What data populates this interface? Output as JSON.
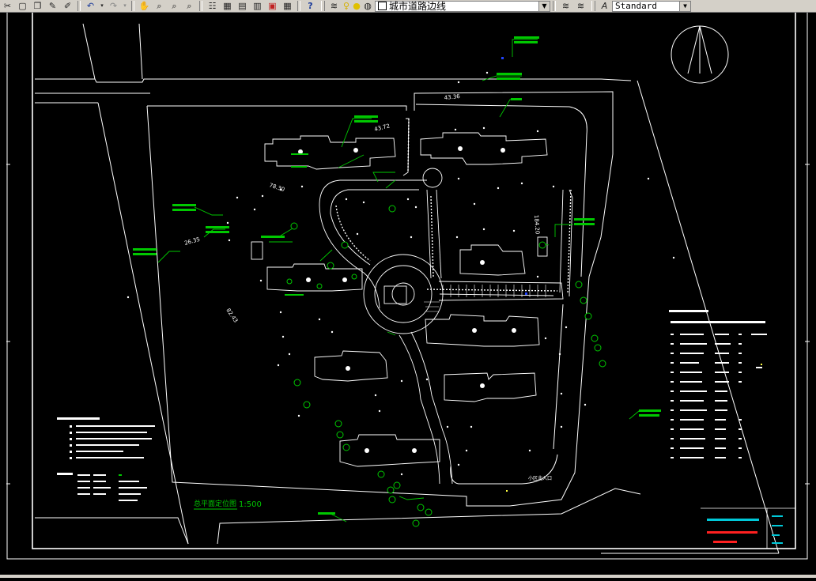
{
  "toolbar": {
    "icons": [
      "cut-icon",
      "new-icon",
      "open-icon",
      "pencil-icon",
      "paint-icon",
      "undo-icon",
      "undo-dropdown-icon",
      "redo-icon",
      "redo-dropdown-icon",
      "pan-icon",
      "zoom-realtime-icon",
      "zoom-window-icon",
      "zoom-previous-icon",
      "properties-icon",
      "design-center-icon",
      "tool-palettes-icon",
      "sheet-set-icon",
      "markup-icon",
      "calculator-icon",
      "help-icon",
      "layer-manager-icon",
      "lightbulb-icon",
      "sun-icon",
      "lock-icon",
      "layer-color-swatch"
    ],
    "layer_name": "城市道路边线",
    "text_style": "Standard"
  },
  "drawing": {
    "title": "总平面定位图",
    "scale": "1:500",
    "dims": [
      "43.36",
      "43.72",
      "78.30",
      "26.35",
      "82.43",
      "184.20"
    ],
    "entrance_label": "小区北入口",
    "colors": {
      "background": "#000000",
      "lines": "#ffffff",
      "green": "#00c800",
      "cyan": "#00c8d8",
      "red": "#ff2020",
      "yellow": "#ffff40",
      "blue": "#2244ff"
    }
  }
}
